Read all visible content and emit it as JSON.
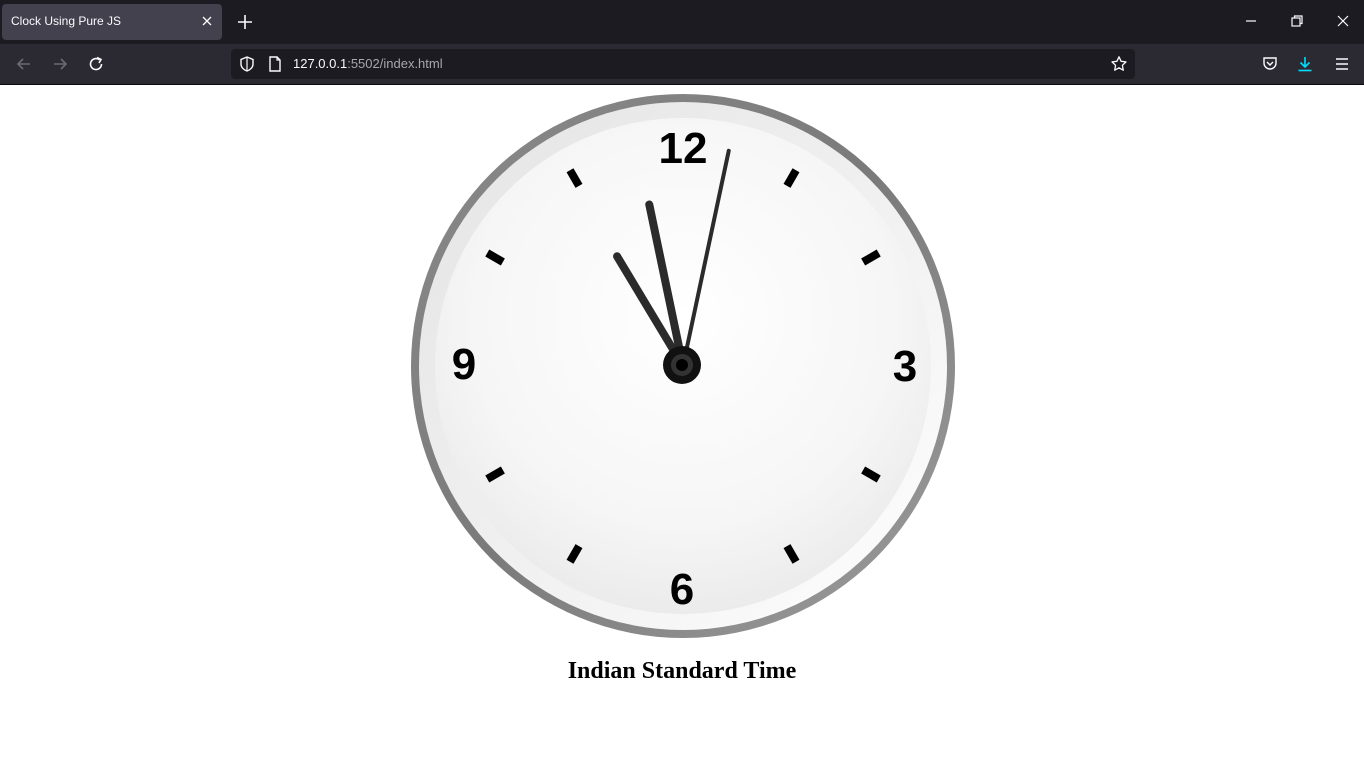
{
  "browser": {
    "tab": {
      "title": "Clock Using Pure JS"
    },
    "url": {
      "host": "127.0.0.1",
      "rest": ":5502/index.html"
    }
  },
  "icons": {
    "tab_close": "close-icon",
    "new_tab": "plus-icon",
    "minimize": "minimize-icon",
    "restore": "restore-icon",
    "close_window": "close-icon",
    "back": "arrow-left-icon",
    "forward": "arrow-right-icon",
    "reload": "reload-icon",
    "shield": "shield-icon",
    "page": "page-icon",
    "bookmark": "star-icon",
    "pocket": "pocket-icon",
    "downloads": "download-icon",
    "menu": "hamburger-menu-icon"
  },
  "clock": {
    "numerals": {
      "twelve": "12",
      "three": "3",
      "six": "6",
      "nine": "9"
    },
    "time": {
      "hour": 10,
      "minute": 58,
      "second": 2
    },
    "caption": "Indian Standard Time"
  },
  "colors": {
    "tabstrip_bg": "#1c1b22",
    "tab_active_bg": "#42414d",
    "navbar_bg": "#2b2a33",
    "download_accent": "#00ddff",
    "hand_color": "#2b2b2b"
  }
}
